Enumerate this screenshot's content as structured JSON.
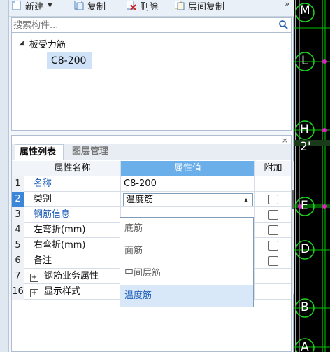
{
  "toolbar": {
    "new_label": "新建",
    "copy_label": "复制",
    "delete_label": "删除",
    "layer_copy_label": "层间复制",
    "more": "»"
  },
  "search": {
    "placeholder": "搜索构件..."
  },
  "tree": {
    "category": "板受力筋",
    "item": "C8-200"
  },
  "panel": {
    "close": "×"
  },
  "tabs": {
    "properties": "属性列表",
    "layers": "图层管理"
  },
  "grid": {
    "headers": {
      "name": "属性名称",
      "value": "属性值",
      "add": "附加"
    },
    "rows": [
      {
        "num": "1",
        "name": "名称",
        "value": "C8-200"
      },
      {
        "num": "2",
        "name": "类别",
        "value": "温度筋"
      },
      {
        "num": "3",
        "name": "钢筋信息",
        "value": ""
      },
      {
        "num": "4",
        "name": "左弯折(mm)",
        "value": ""
      },
      {
        "num": "5",
        "name": "右弯折(mm)",
        "value": ""
      },
      {
        "num": "6",
        "name": "备注",
        "value": ""
      },
      {
        "num": "7",
        "name": "钢筋业务属性",
        "value": ""
      },
      {
        "num": "16",
        "name": "显示样式",
        "value": ""
      }
    ]
  },
  "dropdown": {
    "options": [
      "底筋",
      "面筋",
      "中间层筋",
      "温度筋"
    ],
    "selected": "温度筋"
  },
  "canvas": {
    "axis_labels": [
      "M",
      "L",
      "H",
      "2'",
      "E",
      "D",
      "B",
      "A"
    ]
  }
}
